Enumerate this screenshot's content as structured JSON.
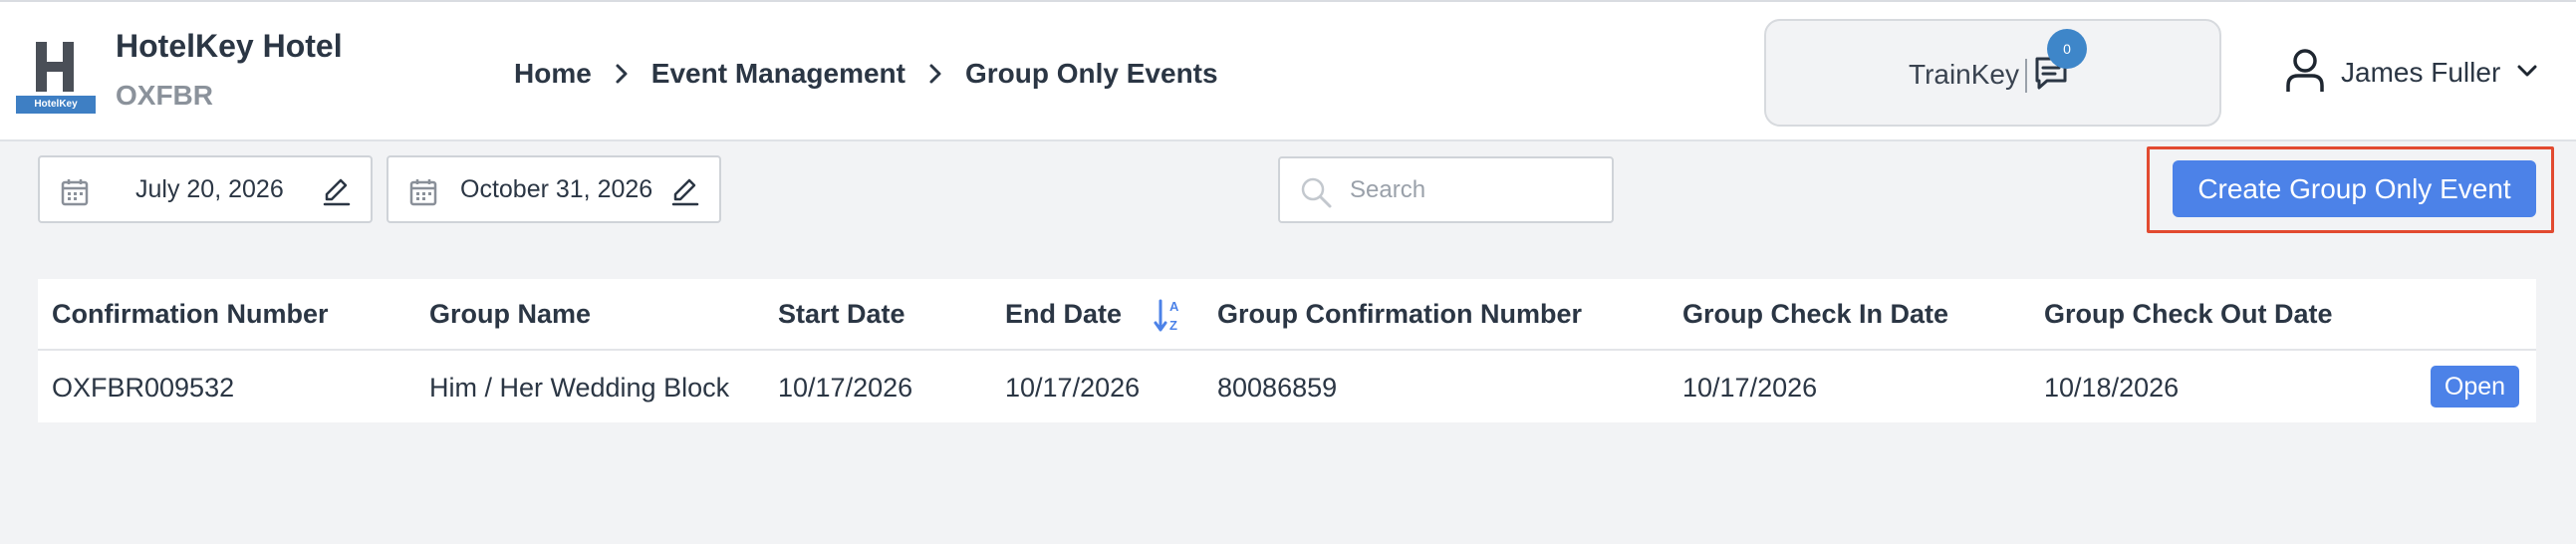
{
  "header": {
    "logo_text": "HotelKey",
    "hotel_name": "HotelKey Hotel",
    "hotel_code": "OXFBR",
    "breadcrumb": [
      "Home",
      "Event Management",
      "Group Only Events"
    ],
    "trainkey_label": "TrainKey",
    "chat_badge_count": "0",
    "user_name": "James Fuller"
  },
  "filters": {
    "start_date": "July 20, 2026",
    "end_date": "October 31, 2026",
    "search_placeholder": "Search",
    "search_value": ""
  },
  "actions": {
    "create_label": "Create Group Only Event",
    "highlight_color": "#e24a30",
    "button_color": "#4c82e8"
  },
  "table": {
    "columns": [
      "Confirmation Number",
      "Group Name",
      "Start Date",
      "End Date",
      "Group Confirmation Number",
      "Group Check In Date",
      "Group Check Out Date"
    ],
    "sorted_column": "End Date",
    "rows": [
      {
        "confirmation_number": "OXFBR009532",
        "group_name": "Him / Her Wedding Block",
        "start_date": "10/17/2026",
        "end_date": "10/17/2026",
        "group_confirmation_number": "80086859",
        "group_check_in_date": "10/17/2026",
        "group_check_out_date": "10/18/2026",
        "action_label": "Open"
      }
    ]
  }
}
